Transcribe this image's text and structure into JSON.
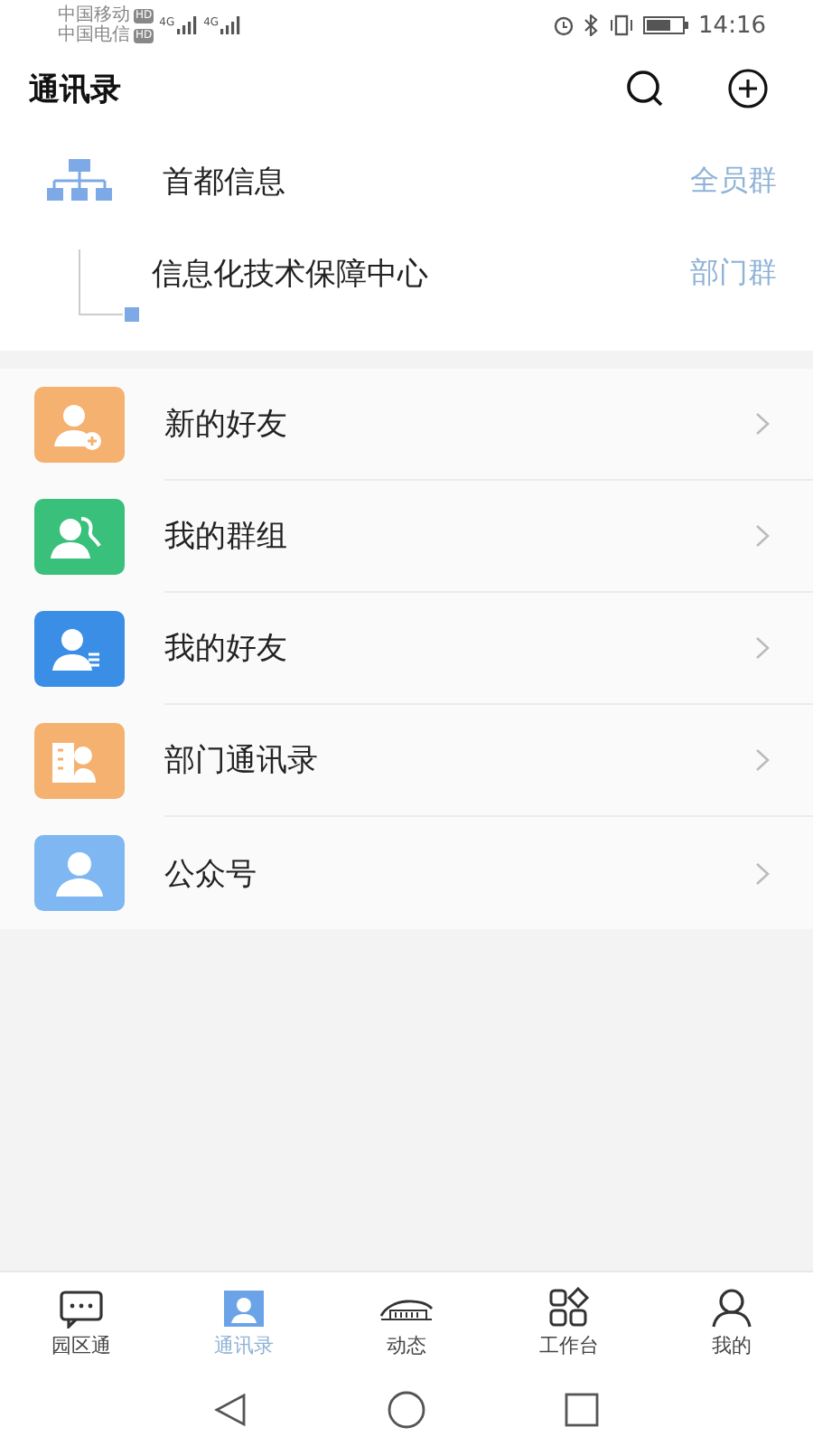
{
  "status_bar": {
    "carriers": [
      {
        "name": "中国移动",
        "badge": "HD"
      },
      {
        "name": "中国电信",
        "badge": "HD"
      }
    ],
    "networks": [
      "4G",
      "4G"
    ],
    "time": "14:16"
  },
  "header": {
    "title": "通讯录"
  },
  "org": {
    "name": "首都信息",
    "tag": "全员群",
    "children": [
      {
        "name": "信息化技术保障中心",
        "tag": "部门群"
      }
    ]
  },
  "items": [
    {
      "label": "新的好友",
      "kind": "person-add",
      "color": "#f4b16f"
    },
    {
      "label": "我的群组",
      "kind": "group",
      "color": "#39c07a"
    },
    {
      "label": "我的好友",
      "kind": "person-list",
      "color": "#3a8ee6"
    },
    {
      "label": "部门通讯录",
      "kind": "building",
      "color": "#f4b16f"
    },
    {
      "label": "公众号",
      "kind": "person",
      "color": "#7fb7f2"
    }
  ],
  "tabs": [
    {
      "label": "园区通",
      "kind": "chat",
      "selected": false
    },
    {
      "label": "通讯录",
      "kind": "contacts",
      "selected": true
    },
    {
      "label": "动态",
      "kind": "dome",
      "selected": false
    },
    {
      "label": "工作台",
      "kind": "grid",
      "selected": false
    },
    {
      "label": "我的",
      "kind": "user",
      "selected": false
    }
  ]
}
